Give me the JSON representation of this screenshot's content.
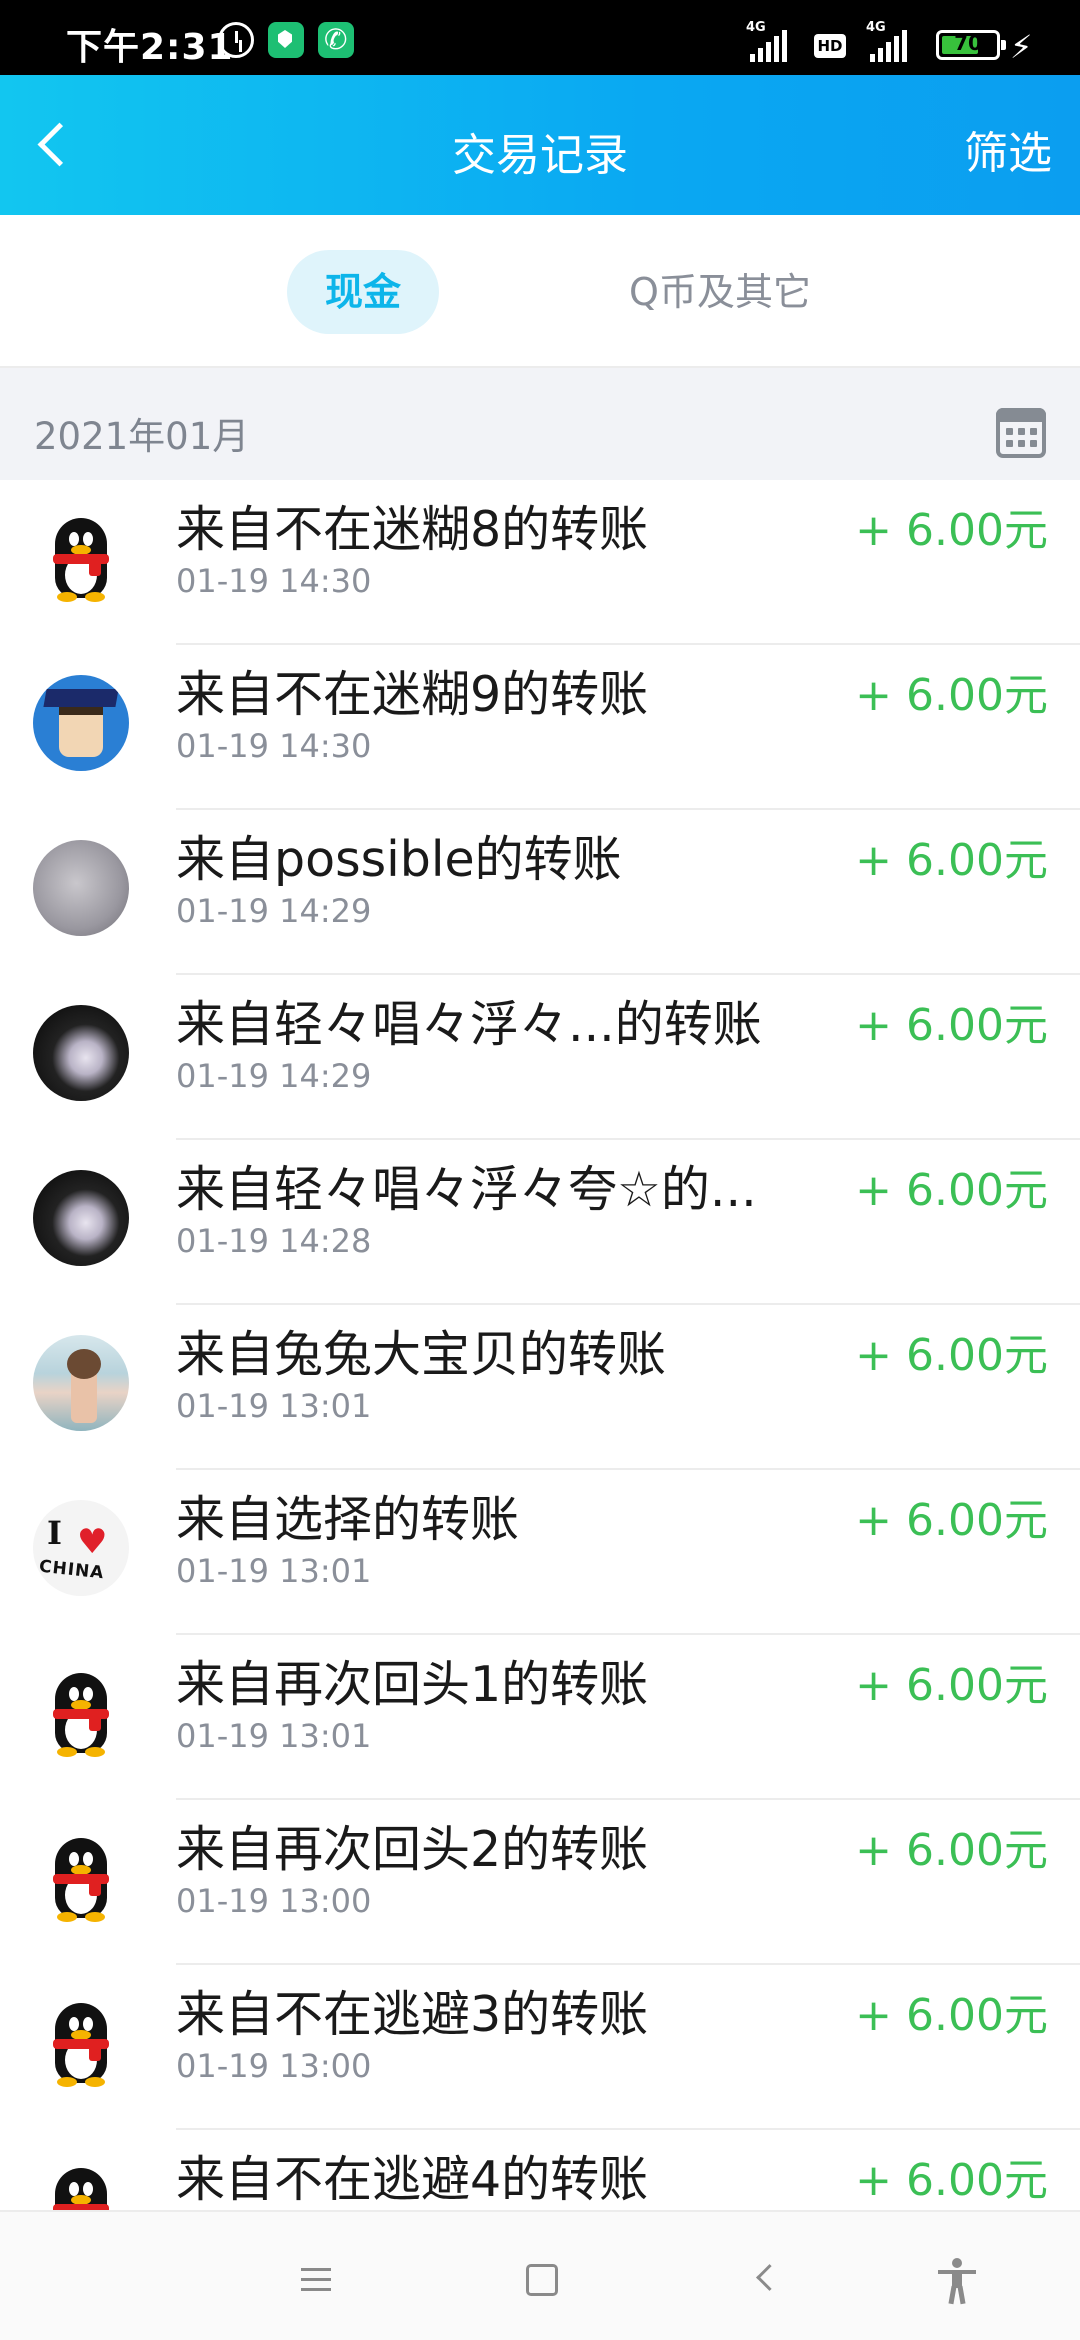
{
  "status_bar": {
    "time": "下午2:31",
    "network1": "4G",
    "hd": "HD",
    "network2": "4G",
    "battery": "70",
    "battery_level": 0.7
  },
  "header": {
    "title": "交易记录",
    "filter_label": "筛选"
  },
  "tabs": [
    {
      "label": "现金",
      "selected": true
    },
    {
      "label": "Q币及其它",
      "selected": false
    }
  ],
  "month": {
    "label": "2021年01月"
  },
  "colors": {
    "header_start": "#12c6f0",
    "header_end": "#0b9ef0",
    "accent": "#0db5ea",
    "amount_green": "#3bbf55"
  },
  "transactions": [
    {
      "title": "来自不在迷糊8的转账",
      "time": "01-19 14:30",
      "amount": "+ 6.00元",
      "avatar": "penguin-icon"
    },
    {
      "title": "来自不在迷糊9的转账",
      "time": "01-19 14:30",
      "amount": "+ 6.00元",
      "avatar": "cartoon-graduate"
    },
    {
      "title": "来自possible的转账",
      "time": "01-19 14:29",
      "amount": "+ 6.00元",
      "avatar": "gray-portrait"
    },
    {
      "title": "来自轻々唱々浮々...的转账",
      "time": "01-19 14:29",
      "amount": "+ 6.00元",
      "avatar": "dark-portrait"
    },
    {
      "title": "来自轻々唱々浮々夸☆的...",
      "time": "01-19 14:28",
      "amount": "+ 6.00元",
      "avatar": "dark-portrait"
    },
    {
      "title": "来自兔兔大宝贝的转账",
      "time": "01-19 13:01",
      "amount": "+ 6.00元",
      "avatar": "photo-portrait"
    },
    {
      "title": "来自选择的转账",
      "time": "01-19 13:01",
      "amount": "+ 6.00元",
      "avatar": "i-love-china"
    },
    {
      "title": "来自再次回头1的转账",
      "time": "01-19 13:01",
      "amount": "+ 6.00元",
      "avatar": "penguin-icon"
    },
    {
      "title": "来自再次回头2的转账",
      "time": "01-19 13:00",
      "amount": "+ 6.00元",
      "avatar": "penguin-icon"
    },
    {
      "title": "来自不在逃避3的转账",
      "time": "01-19 13:00",
      "amount": "+ 6.00元",
      "avatar": "penguin-icon"
    },
    {
      "title": "来自不在逃避4的转账",
      "time": "",
      "amount": "+ 6.00元",
      "avatar": "penguin-icon"
    }
  ],
  "avatar_china": {
    "line1": "I",
    "heart": "♥",
    "line2": "CHINA"
  },
  "nav_bar": {
    "buttons": [
      "menu-icon",
      "home-icon",
      "back-icon",
      "accessibility-icon"
    ]
  }
}
